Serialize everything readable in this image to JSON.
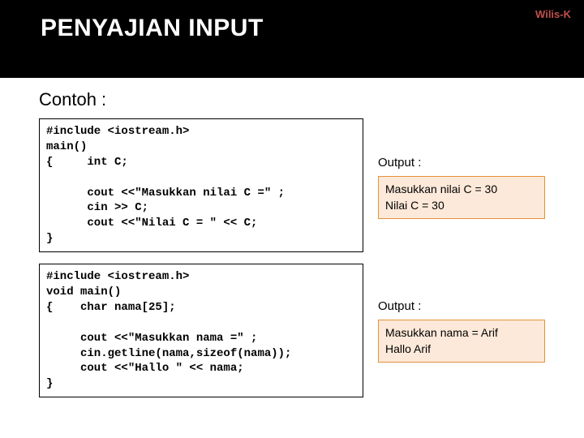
{
  "header": {
    "title": "PENYAJIAN INPUT",
    "author": "Wilis-K"
  },
  "contoh": "Contoh :",
  "block1": {
    "code": "#include <iostream.h>\nmain()\n{     int C;\n\n      cout <<\"Masukkan nilai C =\" ;\n      cin >> C;\n      cout <<\"Nilai C = \" << C;\n}",
    "output_label": "Output :",
    "output": "Masukkan nilai C = 30\nNilai C = 30"
  },
  "block2": {
    "code": "#include <iostream.h>\nvoid main()\n{    char nama[25];\n\n     cout <<\"Masukkan nama =\" ;\n     cin.getline(nama,sizeof(nama));\n     cout <<\"Hallo \" << nama;\n}",
    "output_label": "Output :",
    "output": "Masukkan  nama =  Arif\nHallo  Arif"
  }
}
